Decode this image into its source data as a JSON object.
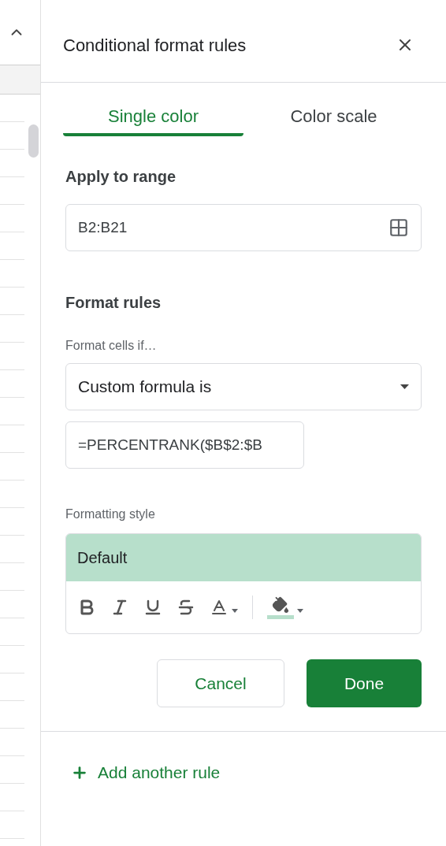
{
  "panel": {
    "title": "Conditional format rules"
  },
  "tabs": [
    {
      "label": "Single color",
      "selected": true
    },
    {
      "label": "Color scale",
      "selected": false
    }
  ],
  "range": {
    "label": "Apply to range",
    "value": "B2:B21"
  },
  "rules": {
    "heading": "Format rules",
    "condition_label": "Format cells if…",
    "condition": "Custom formula is",
    "formula": "=PERCENTRANK($B$2:$B"
  },
  "style": {
    "label": "Formatting style",
    "preview": "Default"
  },
  "buttons": {
    "cancel": "Cancel",
    "done": "Done"
  },
  "add_rule": "Add another rule"
}
